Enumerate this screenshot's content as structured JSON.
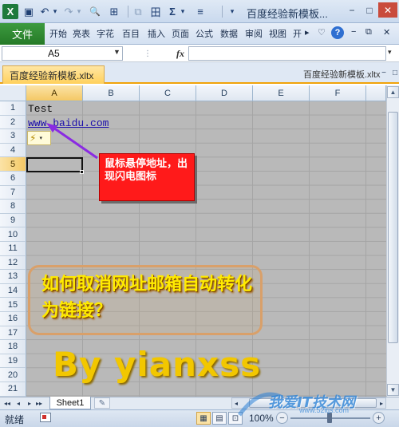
{
  "titlebar": {
    "title": "百度经验新模板...",
    "quick_access": [
      {
        "icon": "excel-logo-icon",
        "glyph": "X"
      },
      {
        "icon": "save-icon",
        "glyph": "▣"
      },
      {
        "icon": "undo-icon",
        "glyph": "↶"
      },
      {
        "icon": "undo-dropdown-icon",
        "glyph": "▾"
      },
      {
        "icon": "redo-icon",
        "glyph": "↷"
      },
      {
        "icon": "redo-dropdown-icon",
        "glyph": "▾"
      },
      {
        "icon": "print-preview-icon",
        "glyph": "🔍"
      },
      {
        "icon": "form-icon",
        "glyph": "⊞"
      },
      {
        "icon": "copy-icon",
        "glyph": "⧉"
      },
      {
        "icon": "table-icon",
        "glyph": "田"
      },
      {
        "icon": "autosum-icon",
        "glyph": "Σ"
      },
      {
        "icon": "autosum-dropdown-icon",
        "glyph": "▾"
      },
      {
        "icon": "align-icon",
        "glyph": "≡"
      },
      {
        "icon": "customize-qat-icon",
        "glyph": "▾"
      }
    ],
    "window_buttons": [
      "−",
      "□",
      "✕"
    ]
  },
  "ribbon": {
    "file_tab": "文件",
    "tabs": [
      "开始",
      "亮表",
      "字花",
      "百目",
      "插入",
      "页面",
      "公式",
      "数据",
      "审阅",
      "视图",
      "开"
    ],
    "right_icons": [
      "▸",
      "♡",
      "?",
      "−",
      "⧉",
      "✕"
    ]
  },
  "formula_bar": {
    "name_box": "A5",
    "fx_label": "fx",
    "formula": ""
  },
  "workbook": {
    "tab_label": "百度经验新模板.xltx",
    "window_title": "百度经验新模板.xltx",
    "controls": [
      "−",
      "□",
      "✕"
    ]
  },
  "grid": {
    "columns": [
      "A",
      "B",
      "C",
      "D",
      "E",
      "F"
    ],
    "selected_column": "A",
    "rows": [
      "1",
      "2",
      "3",
      "4",
      "5",
      "6",
      "7",
      "8",
      "9",
      "10",
      "11",
      "12",
      "13",
      "14",
      "15",
      "16",
      "17",
      "18",
      "19",
      "20",
      "21"
    ],
    "selected_row": "5",
    "cells": {
      "A1": "Test",
      "A2": "www.baidu.com"
    },
    "autocorrect_glyph": "⚡",
    "autocorrect_arrow": "▾"
  },
  "annotation": {
    "callout": "鼠标悬停地址，出现闪电图标",
    "box_text": "如何取消网址邮箱自动转化为链接？",
    "byline": "By yianxss",
    "arrow_color": "#8a2be2",
    "callout_color": "#ff1a1a",
    "text_color": "#ffea00"
  },
  "sheets": {
    "tabs": [
      "Sheet1"
    ],
    "nav": [
      "◂◂",
      "◂",
      "▸",
      "▸▸"
    ],
    "new_sheet_glyph": "✎"
  },
  "statusbar": {
    "status": "就绪",
    "zoom": "100%",
    "zoom_level_percent": 100,
    "view_buttons": [
      "▦",
      "▤",
      "⊡"
    ],
    "zoom_minus": "−",
    "zoom_plus": "+"
  },
  "watermark": {
    "text": "我爱IT技术网",
    "sub": "www.52itjs.com"
  },
  "scrollbar": {
    "up": "▲",
    "down": "▼",
    "left": "◂",
    "right": "▸"
  }
}
